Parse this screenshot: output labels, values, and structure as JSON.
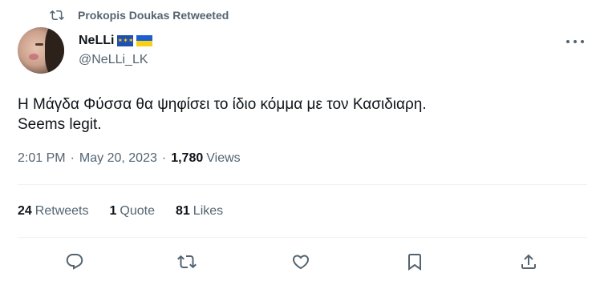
{
  "social_context": {
    "text": "Prokopis Doukas Retweeted",
    "icon": "retweet-icon"
  },
  "author": {
    "display_name": "NeLLi",
    "handle": "@NeLLi_LK",
    "badges": [
      "eu-flag",
      "ukraine-flag"
    ]
  },
  "tweet": {
    "lines": [
      "Η Μάγδα Φύσσα θα ψηφίσει το ίδιο κόμμα με τον Κασιδιαρη.",
      "Seems legit."
    ]
  },
  "meta": {
    "time": "2:01 PM",
    "date": "May 20, 2023",
    "separator": "·",
    "views_count": "1,780",
    "views_label": "Views"
  },
  "stats": {
    "retweets": {
      "count": "24",
      "label": "Retweets"
    },
    "quotes": {
      "count": "1",
      "label": "Quote"
    },
    "likes": {
      "count": "81",
      "label": "Likes"
    }
  },
  "actions": [
    "reply-icon",
    "retweet-icon",
    "like-icon",
    "bookmark-icon",
    "share-icon"
  ],
  "colors": {
    "text": "#0f1419",
    "secondary": "#536471",
    "divider": "#eff3f4"
  }
}
